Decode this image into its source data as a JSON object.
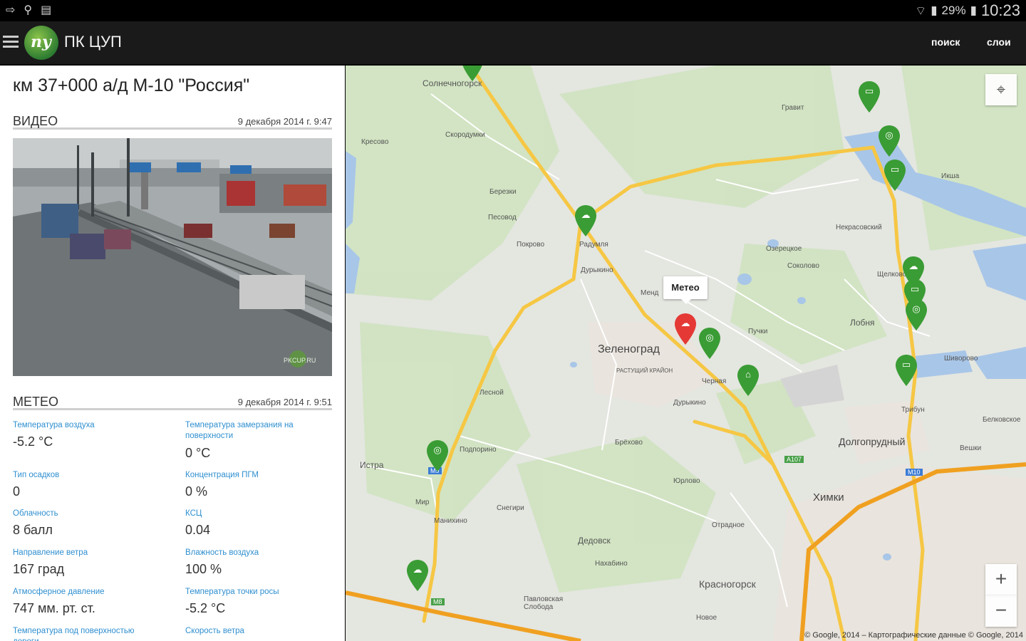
{
  "status_bar": {
    "battery": "29%",
    "time": "10:23"
  },
  "app": {
    "title": "ПК ЦУП",
    "search_label": "поиск",
    "layers_label": "слои"
  },
  "place": {
    "title": "км 37+000 а/д М-10 \"Россия\""
  },
  "video": {
    "header": "ВИДЕО",
    "date": "9 декабря 2014 г. 9:47",
    "watermark": "PKCUP.RU"
  },
  "meteo": {
    "header": "МЕТЕО",
    "date": "9 декабря 2014 г. 9:51",
    "fields": [
      {
        "label": "Температура воздуха",
        "value": "-5.2 °C"
      },
      {
        "label": "Температура замерзания на поверхности",
        "value": "0 °C"
      },
      {
        "label": "Тип осадков",
        "value": "0"
      },
      {
        "label": "Концентрация ПГМ",
        "value": "0 %"
      },
      {
        "label": "Облачность",
        "value": "8 балл"
      },
      {
        "label": "КСЦ",
        "value": "0.04"
      },
      {
        "label": "Направление ветра",
        "value": "167 град"
      },
      {
        "label": "Влажность воздуха",
        "value": "100 %"
      },
      {
        "label": "Атмосферное давление",
        "value": "747 мм. рт. ст."
      },
      {
        "label": "Температура точки росы",
        "value": "-5.2 °C"
      },
      {
        "label": "Температура под поверхностью дороги",
        "value": ""
      },
      {
        "label": "Скорость ветра",
        "value": ""
      }
    ]
  },
  "map": {
    "tooltip": "Метео",
    "zoom_in": "+",
    "zoom_out": "−",
    "copyright": "© Google, 2014 – Картографические данные © Google, 2014",
    "labels": {
      "solnechnogorsk": "Солнечногорск",
      "skorodumki": "Скородумки",
      "kresovo": "Кресово",
      "gravit": "Гравит",
      "berezki": "Березки",
      "pesovod": "Песовод",
      "pokrovo": "Покрово",
      "radumlya": "Радумля",
      "durykino": "Дурыкино",
      "ozeretskoe": "Озерецкое",
      "sokolovo": "Соколово",
      "nekrasovsky": "Некрасовский",
      "iksha": "Икша",
      "mend": "Менд",
      "lobnya": "Лобня",
      "zelenograd": "Зеленоград",
      "rastushchiy": "РАСТУЩИЙ КРАЙОН",
      "chernaya": "Черная",
      "pyatnitsa": "Пучки",
      "dzhurovo": "Дурыкино",
      "lesnoy": "Лесной",
      "podporino": "Подпорино",
      "istra": "Истра",
      "brekovo": "Брёхово",
      "dolgoprudny": "Долгопрудный",
      "vashki": "Вешки",
      "khimki": "Химки",
      "yurlovo": "Юрлово",
      "mir": "Мир",
      "manikhino": "Манихино",
      "snegiri": "Снегири",
      "dedovsk": "Дедовск",
      "nakhabino": "Нахабино",
      "krasnogorsk": "Красногорск",
      "pavlovskaya": "Павловская Слобода",
      "novoe": "Новое",
      "otradnoe": "Отрадное",
      "shchelkovo": "Щелково",
      "shiryaevo": "Шиворово",
      "tribun": "Трибун",
      "beloye": "Белковское"
    },
    "road_shields": {
      "m9": "M9",
      "a107": "A107",
      "m10": "M10",
      "m8": "M8"
    }
  }
}
